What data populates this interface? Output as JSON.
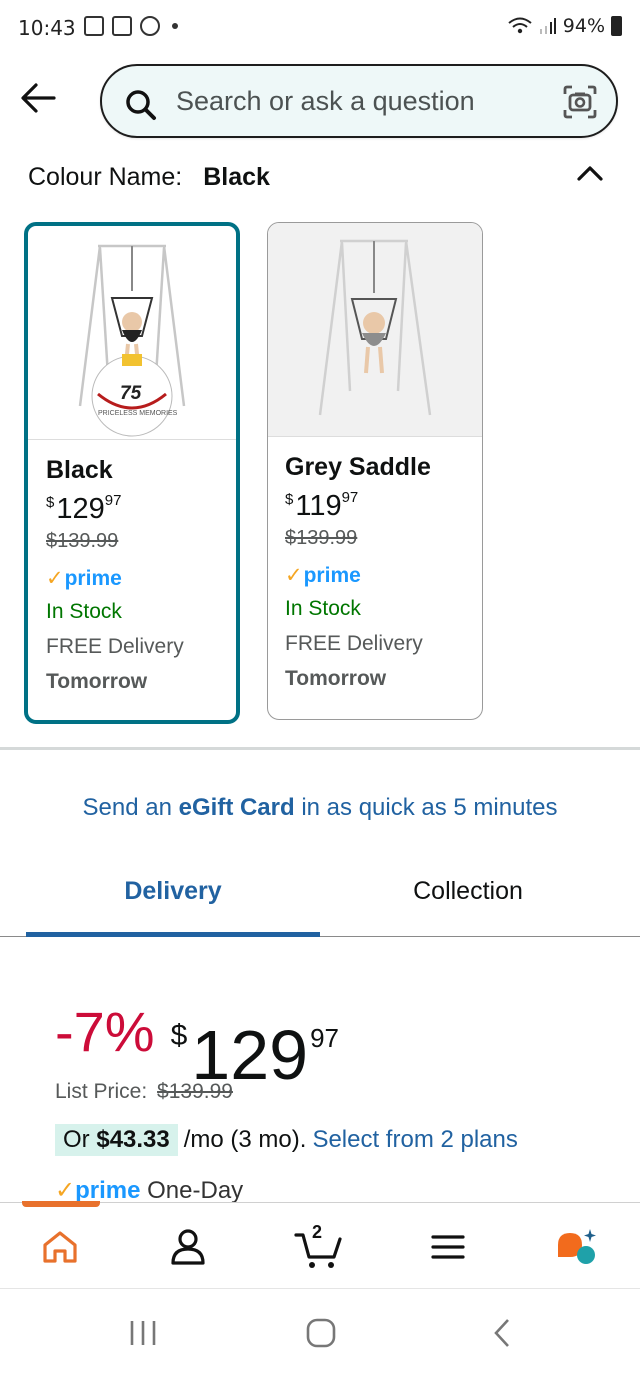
{
  "status_bar": {
    "time": "10:43",
    "battery": "94%"
  },
  "search": {
    "placeholder": "Search or ask a question"
  },
  "colour": {
    "label": "Colour Name:",
    "value": "Black"
  },
  "variants": [
    {
      "name": "Black",
      "currency": "$",
      "price_whole": "129",
      "price_fraction": "97",
      "was_price": "$139.99",
      "prime": "prime",
      "stock": "In Stock",
      "delivery": "FREE Delivery",
      "delivery_date": "Tomorrow",
      "selected": true
    },
    {
      "name": "Grey Saddle",
      "currency": "$",
      "price_whole": "119",
      "price_fraction": "97",
      "was_price": "$139.99",
      "prime": "prime",
      "stock": "In Stock",
      "delivery": "FREE Delivery",
      "delivery_date": "Tomorrow",
      "selected": false
    }
  ],
  "product_image_text": {
    "badge_number": "75",
    "badge_caption": "PRICELESS MEMORIES"
  },
  "egift": {
    "prefix": "Send an",
    "bold": "eGift Card",
    "suffix": "in as quick as 5 minutes"
  },
  "tabs": [
    {
      "label": "Delivery",
      "active": true
    },
    {
      "label": "Collection",
      "active": false
    }
  ],
  "buybox": {
    "discount": "-7%",
    "currency": "$",
    "price_whole": "129",
    "price_fraction": "97",
    "list_price_label": "List Price:",
    "list_price": "$139.99",
    "plan_prefix": "Or",
    "plan_amount": "$43.33",
    "plan_term": "/mo (3 mo).",
    "plan_link": "Select from 2 plans",
    "prime_word": "prime",
    "one_day": "One-Day"
  },
  "bottom_nav": {
    "cart_count": "2",
    "items": [
      "home-icon",
      "account-icon",
      "cart-icon",
      "menu-icon",
      "rufus-icon"
    ]
  },
  "colors": {
    "accent_teal": "#007185",
    "link_blue": "#2162a1",
    "prime_blue": "#1a98ff",
    "stock_green": "#007600",
    "deal_red": "#cc0c39",
    "home_orange": "#e8712c"
  }
}
